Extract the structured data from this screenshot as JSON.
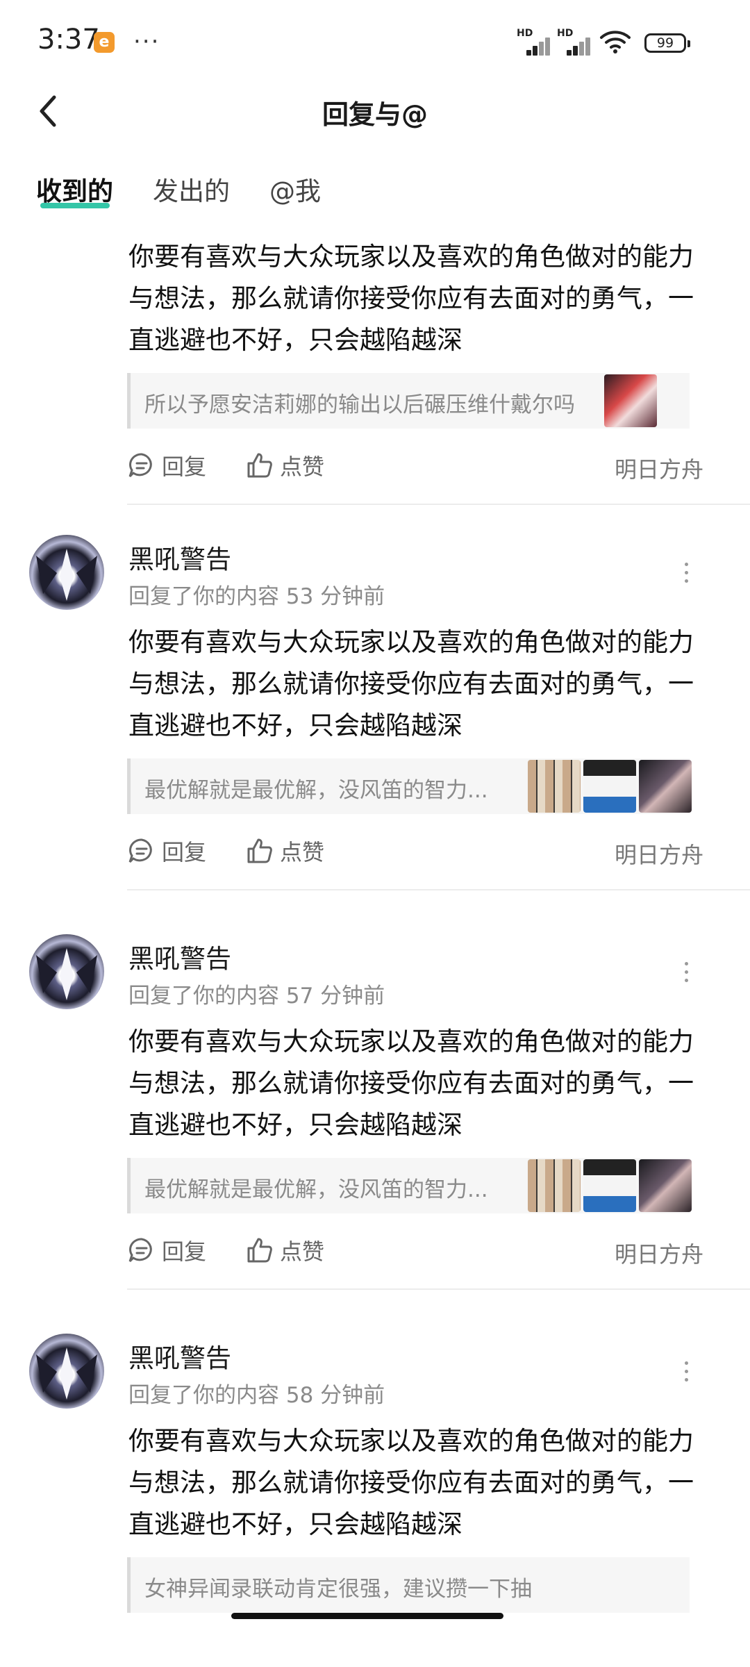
{
  "status_bar": {
    "time": "3:37",
    "app_badge": "e",
    "more": "···",
    "network_label": "HD",
    "battery": "99"
  },
  "header": {
    "title": "回复与@"
  },
  "tabs": [
    {
      "label": "收到的",
      "active": true
    },
    {
      "label": "发出的",
      "active": false
    },
    {
      "label": "@我",
      "active": false
    }
  ],
  "actions": {
    "reply": "回复",
    "like": "点赞"
  },
  "items": [
    {
      "body": "你要有喜欢与大众玩家以及喜欢的角色做对的能力与想法，那么就请你接受你应有去面对的勇气，一直逃避也不好，只会越陷越深",
      "quote": "所以予愿安洁莉娜的输出以后碾压维什戴尔吗",
      "source": "明日方舟"
    },
    {
      "user": "黑吼警告",
      "meta": "回复了你的内容 53 分钟前",
      "body": "你要有喜欢与大众玩家以及喜欢的角色做对的能力与想法，那么就请你接受你应有去面对的勇气，一直逃避也不好，只会越陷越深",
      "quote": "最优解就是最优解，没风笛的智力...",
      "source": "明日方舟"
    },
    {
      "user": "黑吼警告",
      "meta": "回复了你的内容 57 分钟前",
      "body": "你要有喜欢与大众玩家以及喜欢的角色做对的能力与想法，那么就请你接受你应有去面对的勇气，一直逃避也不好，只会越陷越深",
      "quote": "最优解就是最优解，没风笛的智力...",
      "source": "明日方舟"
    },
    {
      "user": "黑吼警告",
      "meta": "回复了你的内容 58 分钟前",
      "body": "你要有喜欢与大众玩家以及喜欢的角色做对的能力与想法，那么就请你接受你应有去面对的勇气，一直逃避也不好，只会越陷越深",
      "quote": "女神异闻录联动肯定很强，建议攒一下抽"
    }
  ]
}
